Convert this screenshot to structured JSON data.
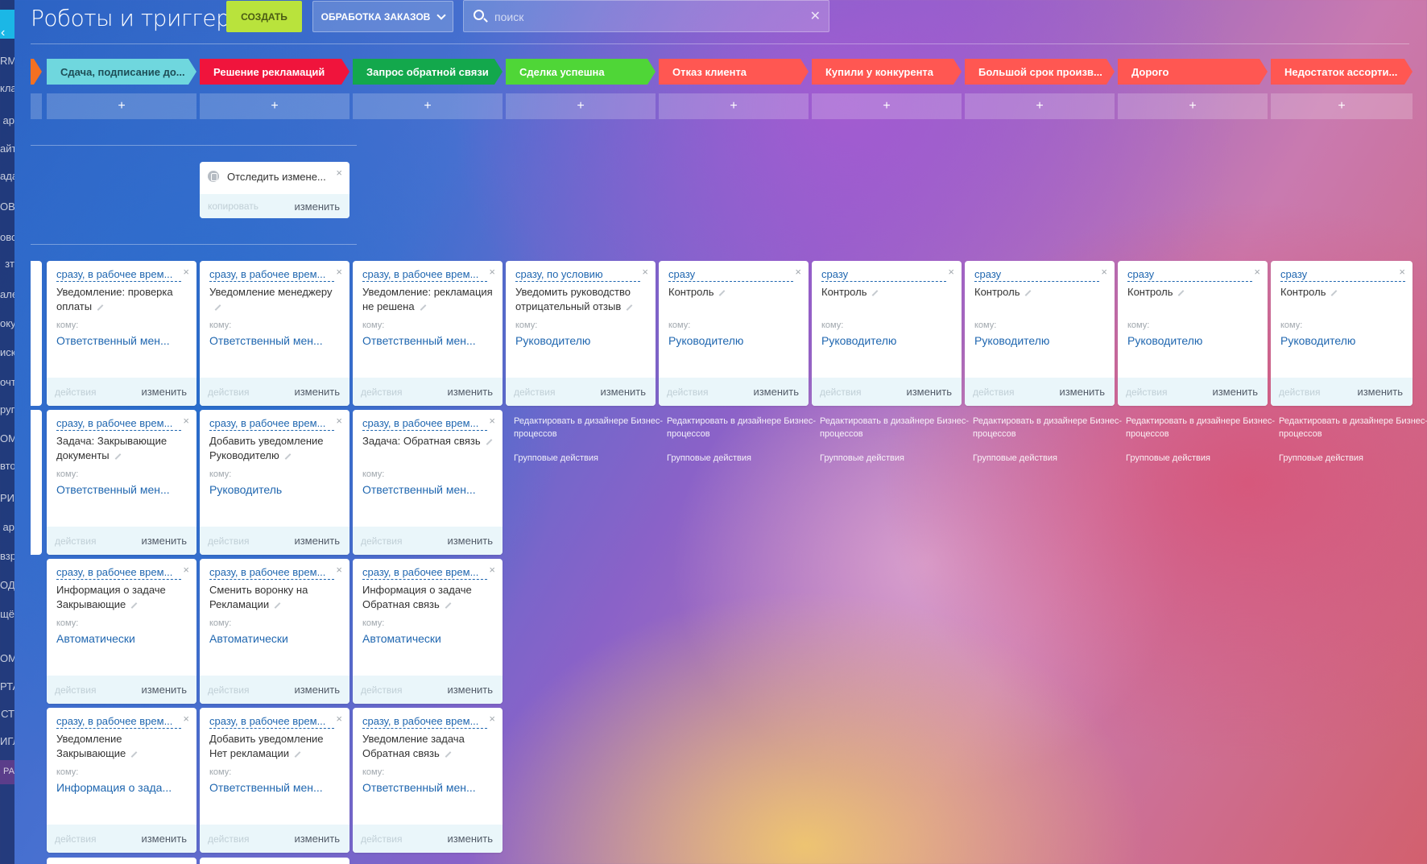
{
  "header": {
    "title": "Роботы и триггеры",
    "create_label": "СОЗДАТЬ",
    "pipeline_label": "ОБРАБОТКА ЗАКАЗОВ",
    "search_placeholder": "поиск"
  },
  "left_sidebar_fragments": [
    "RM",
    "кла",
    "ар",
    "айт",
    "ада",
    "ОВ",
    "ово",
    "зт",
    "але",
    "оку",
    "иск",
    "очт",
    "руп",
    "ОМ",
    "вто",
    "РИ",
    "ар",
    "взр",
    "ОД",
    "щё",
    "ОМО",
    "РТА",
    "СТ",
    "ИГЛ",
    "РА"
  ],
  "stages": [
    {
      "label": "",
      "color": "#f37021"
    },
    {
      "label": "Сдача, подписание до...",
      "color": "#6fd7de"
    },
    {
      "label": "Решение рекламаций",
      "color": "#f0143c"
    },
    {
      "label": "Запрос обратной связи",
      "color": "#13a84c"
    },
    {
      "label": "Сделка успешна",
      "color": "#4fd637"
    },
    {
      "label": "Отказ клиента",
      "color": "#ff5752"
    },
    {
      "label": "Купили у конкурента",
      "color": "#ff5752"
    },
    {
      "label": "Большой срок произв...",
      "color": "#ff5752"
    },
    {
      "label": "Дорого",
      "color": "#ff5752"
    },
    {
      "label": "Недостаток ассорти...",
      "color": "#ff5752"
    }
  ],
  "add_label": "+",
  "trigger": {
    "title": "Отследить измене...",
    "copy_label": "копировать",
    "edit_label": "изменить"
  },
  "card_labels": {
    "to": "кому:",
    "actions": "действия",
    "edit": "изменить",
    "close": "×"
  },
  "robots": [
    {
      "cond": "сразу, в рабочее врем...",
      "title": "Уведомление: проверка оплаты",
      "to": "Ответственный мен..."
    },
    {
      "cond": "сразу, в рабочее врем...",
      "title": "Уведомление менеджеру",
      "to": "Ответственный мен..."
    },
    {
      "cond": "сразу, в рабочее врем...",
      "title": "Уведомление: рекламация не решена",
      "to": "Ответственный мен..."
    },
    {
      "cond": "сразу, по условию",
      "title": "Уведомить руководство отрицательный отзыв",
      "to": "Руководителю"
    },
    {
      "cond": "сразу",
      "title": "Контроль",
      "to": "Руководителю"
    },
    {
      "cond": "сразу",
      "title": "Контроль",
      "to": "Руководителю"
    },
    {
      "cond": "сразу",
      "title": "Контроль",
      "to": "Руководителю"
    },
    {
      "cond": "сразу",
      "title": "Контроль",
      "to": "Руководителю"
    },
    {
      "cond": "сразу",
      "title": "Контроль",
      "to": "Руководителю"
    },
    {
      "cond": "сразу, в рабочее врем...",
      "title": "Задача: Закрывающие документы",
      "to": "Ответственный мен..."
    },
    {
      "cond": "сразу, в рабочее врем...",
      "title": "Добавить уведомление Руководителю",
      "to": "Руководитель"
    },
    {
      "cond": "сразу, в рабочее врем...",
      "title": "Задача: Обратная связь",
      "to": "Ответственный мен..."
    },
    {
      "cond": "сразу, в рабочее врем...",
      "title": "Информация о задаче Закрывающие",
      "to": "Автоматически"
    },
    {
      "cond": "сразу, в рабочее врем...",
      "title": "Сменить воронку на Рекламации",
      "to": "Автоматически"
    },
    {
      "cond": "сразу, в рабочее врем...",
      "title": "Информация о задаче Обратная связь",
      "to": "Автоматически"
    },
    {
      "cond": "сразу, в рабочее врем...",
      "title": "Уведомление Закрывающие",
      "to": "Информация о зада..."
    },
    {
      "cond": "сразу, в рабочее врем...",
      "title": "Добавить уведомление Нет рекламации",
      "to": "Ответственный мен..."
    },
    {
      "cond": "сразу, в рабочее врем...",
      "title": "Уведомление задача Обратная связь",
      "to": "Ответственный мен..."
    }
  ],
  "column_footer": {
    "designer_link": "Редактировать в дизайнере Бизнес-процессов",
    "group_actions": "Групповые действия"
  }
}
